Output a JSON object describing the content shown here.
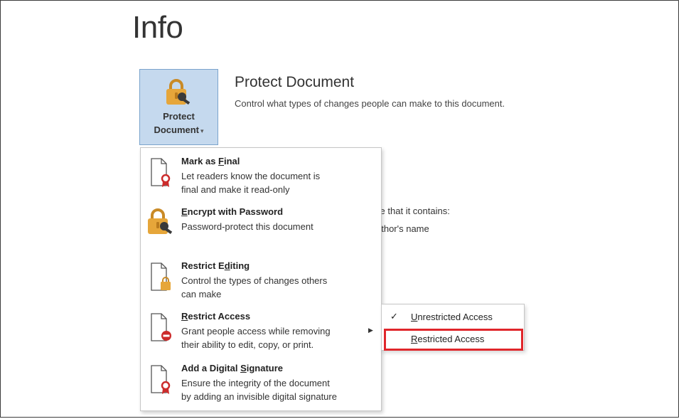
{
  "page": {
    "title": "Info"
  },
  "protect_button": {
    "line1": "Protect",
    "line2": "Document",
    "caret": "▾",
    "icon": "lock-key-icon"
  },
  "section": {
    "title": "Protect Document",
    "description": "Control what types of changes people can make to this document."
  },
  "background_text": {
    "line1": "are that it contains:",
    "line2": "uthor's name"
  },
  "menu": {
    "items": [
      {
        "title_pre": "Mark as ",
        "title_key": "F",
        "title_post": "inal",
        "desc1": "Let readers know the document is",
        "desc2": "final and make it read-only",
        "icon": "mark-final-icon"
      },
      {
        "title_pre": "",
        "title_key": "E",
        "title_post": "ncrypt with Password",
        "desc1": "Password-protect this document",
        "desc2": "",
        "icon": "encrypt-lock-icon"
      },
      {
        "title_pre": "Restrict E",
        "title_key": "d",
        "title_post": "iting",
        "desc1": "Control the types of changes others",
        "desc2": "can make",
        "icon": "restrict-editing-icon"
      },
      {
        "title_pre": "",
        "title_key": "R",
        "title_post": "estrict Access",
        "desc1": "Grant people access while removing",
        "desc2": "their ability to edit, copy, or print.",
        "icon": "restrict-access-icon",
        "has_submenu": true,
        "submenu_arrow": "▶"
      },
      {
        "title_pre": "Add a Digital ",
        "title_key": "S",
        "title_post": "ignature",
        "desc1": "Ensure the integrity of the document",
        "desc2": "by adding an invisible digital signature",
        "icon": "digital-signature-icon"
      }
    ]
  },
  "submenu": {
    "items": [
      {
        "check": "✓",
        "label_key": "U",
        "label_post": "nrestricted Access",
        "checked": true
      },
      {
        "check": "",
        "label_key": "R",
        "label_post": "estricted Access",
        "checked": false,
        "highlighted": true
      }
    ]
  },
  "colors": {
    "accent_bg": "#c5d9ee",
    "highlight": "#e0262b",
    "lock_gold": "#e6a63a"
  }
}
